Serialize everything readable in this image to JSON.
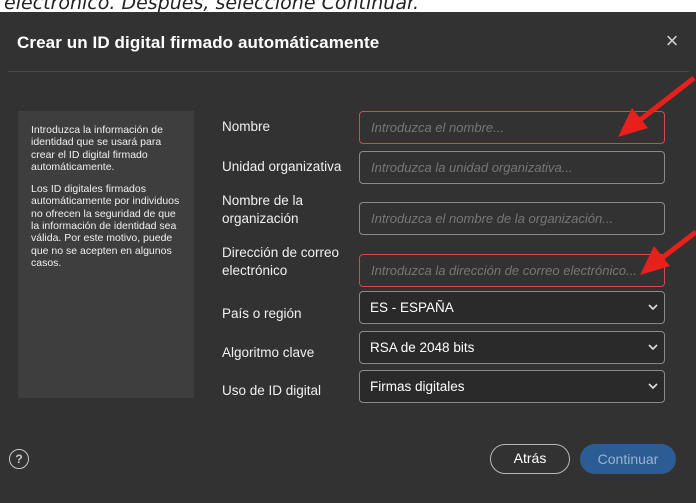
{
  "caption": "electrónico. Después, seleccione Continuar.",
  "dialog": {
    "title": "Crear un ID digital firmado automáticamente",
    "close_icon": "close-icon"
  },
  "info": {
    "paragraph1": "Introduzca la información de identidad que se usará para crear el ID digital firmado automáticamente.",
    "paragraph2": "Los ID digitales firmados automáticamente por individuos no ofrecen la seguridad de que la información de identidad sea válida. Por este motivo, puede que no se acepten en algunos casos."
  },
  "form": {
    "name_label": "Nombre",
    "name_placeholder": "Introduzca el nombre...",
    "unit_label": "Unidad organizativa",
    "unit_placeholder": "Introduzca la unidad organizativa...",
    "org_label": "Nombre de la organización",
    "org_placeholder": "Introduzca el nombre de la organización...",
    "email_label": "Dirección de correo electrónico",
    "email_placeholder": "Introduzca la dirección de correo electrónico...",
    "country_label": "País o región",
    "country_value": "ES - ESPAÑA",
    "algo_label": "Algoritmo clave",
    "algo_value": "RSA de 2048 bits",
    "use_label": "Uso de ID digital",
    "use_value": "Firmas digitales"
  },
  "footer": {
    "help_symbol": "?",
    "back_label": "Atrás",
    "continue_label": "Continuar"
  },
  "colors": {
    "dialog_bg": "#323232",
    "panel_bg": "#3e3e3e",
    "error_border": "#d9474a",
    "primary_button": "#2b5c94",
    "annotation_arrow": "#e8201c"
  }
}
